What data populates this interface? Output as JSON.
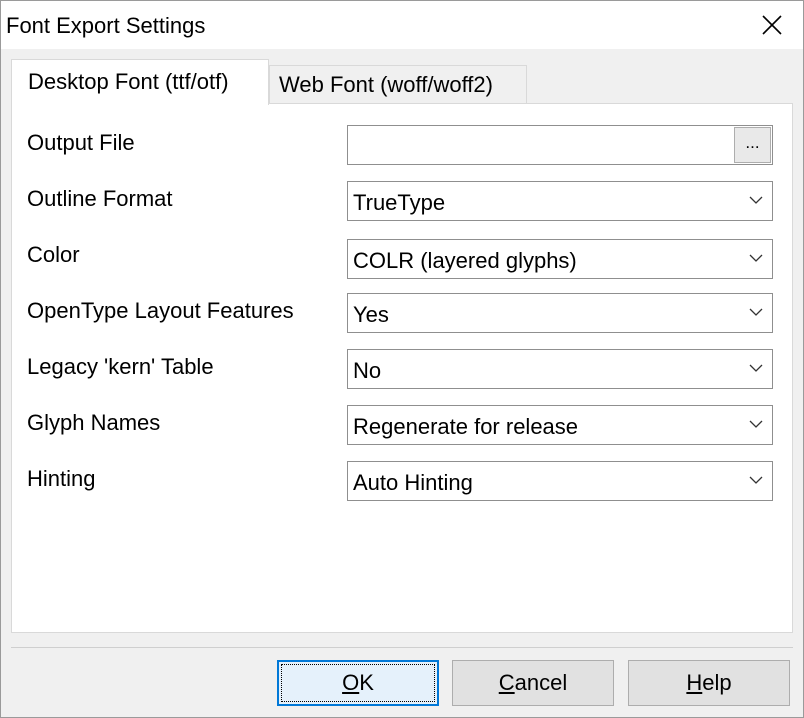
{
  "window": {
    "title": "Font Export Settings"
  },
  "tabs": [
    {
      "label": "Desktop Font (ttf/otf)",
      "selected": true
    },
    {
      "label": "Web Font (woff/woff2)",
      "selected": false
    }
  ],
  "form": {
    "output_file": {
      "label": "Output File",
      "value": "",
      "browse_label": "..."
    },
    "outline_format": {
      "label": "Outline Format",
      "value": "TrueType"
    },
    "color": {
      "label": "Color",
      "value": "COLR (layered glyphs)"
    },
    "opentype_layout": {
      "label": "OpenType Layout Features",
      "value": "Yes"
    },
    "legacy_kern": {
      "label": "Legacy 'kern' Table",
      "value": "No"
    },
    "glyph_names": {
      "label": "Glyph Names",
      "value": "Regenerate for release"
    },
    "hinting": {
      "label": "Hinting",
      "value": "Auto Hinting"
    }
  },
  "buttons": {
    "ok": {
      "first": "O",
      "rest": "K"
    },
    "cancel": {
      "first": "C",
      "rest": "ancel"
    },
    "help": {
      "first": "H",
      "rest": "elp"
    }
  },
  "colors": {
    "accent": "#0078d7",
    "window_bg": "#f0f0f0",
    "panel_bg": "#ffffff"
  },
  "icons": {
    "close": "close-icon",
    "dropdown": "chevron-down-icon"
  }
}
